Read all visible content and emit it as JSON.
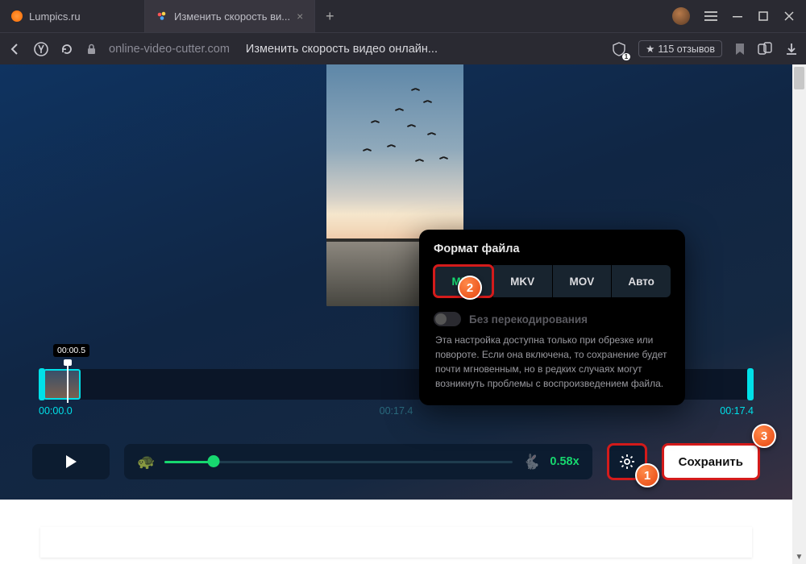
{
  "titlebar": {
    "tabs": [
      {
        "label": "Lumpics.ru"
      },
      {
        "label": "Изменить скорость ви..."
      }
    ],
    "newtab": "+"
  },
  "addressbar": {
    "domain": "online-video-cutter.com",
    "title": "Изменить скорость видео онлайн...",
    "shield_count": "1",
    "reviews": "115 отзывов"
  },
  "timeline": {
    "playhead_label": "00:00.5",
    "start": "00:00.0",
    "mid": "00:17.4",
    "end": "00:17.4"
  },
  "controls": {
    "speed_value": "0.58x",
    "save_label": "Сохранить"
  },
  "popup": {
    "title": "Формат файла",
    "formats": {
      "f0": "MP4",
      "f1": "MKV",
      "f2": "MOV",
      "f3": "Авто"
    },
    "transcode_label": "Без перекодирования",
    "transcode_desc": "Эта настройка доступна только при обрезке или повороте. Если она включена, то сохранение будет почти мгновенным, но в редких случаях могут возникнуть проблемы с воспроизведением файла."
  },
  "badges": {
    "b1": "1",
    "b2": "2",
    "b3": "3"
  }
}
